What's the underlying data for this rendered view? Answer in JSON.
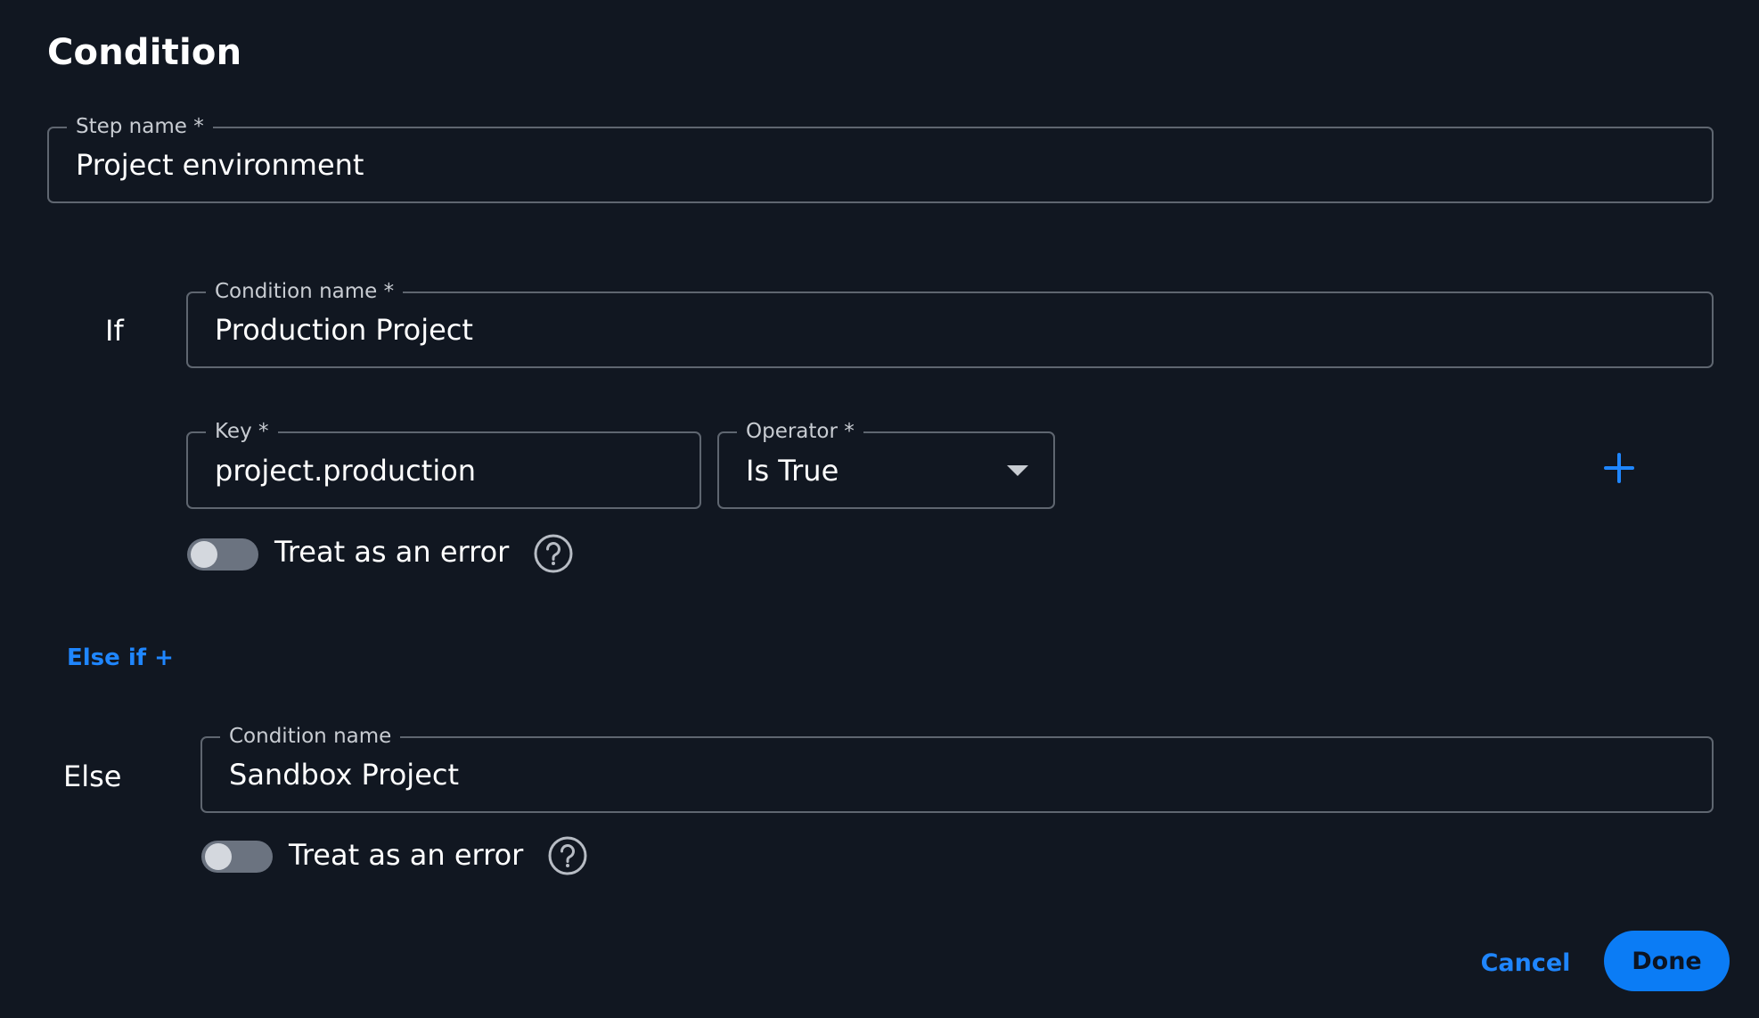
{
  "dialog": {
    "title": "Condition"
  },
  "step_name": {
    "label": "Step name *",
    "value": "Project environment"
  },
  "if_block": {
    "label": "If",
    "condition_name": {
      "label": "Condition name *",
      "value": "Production Project"
    },
    "key": {
      "label": "Key *",
      "value": "project.production"
    },
    "operator": {
      "label": "Operator *",
      "value": "Is True"
    },
    "add_icon": "plus-icon",
    "treat_as_error": {
      "label": "Treat as an error",
      "enabled": false
    },
    "help_icon": "help-circle-icon"
  },
  "else_if": {
    "label": "Else if +"
  },
  "else_block": {
    "label": "Else",
    "condition_name": {
      "label": "Condition name",
      "value": "Sandbox Project"
    },
    "treat_as_error": {
      "label": "Treat as an error",
      "enabled": false
    },
    "help_icon": "help-circle-icon"
  },
  "actions": {
    "cancel_label": "Cancel",
    "done_label": "Done"
  },
  "colors": {
    "background": "#111721",
    "accent": "#1f86ff",
    "primary_button": "#0b7cf5",
    "field_border": "#5f6670"
  }
}
